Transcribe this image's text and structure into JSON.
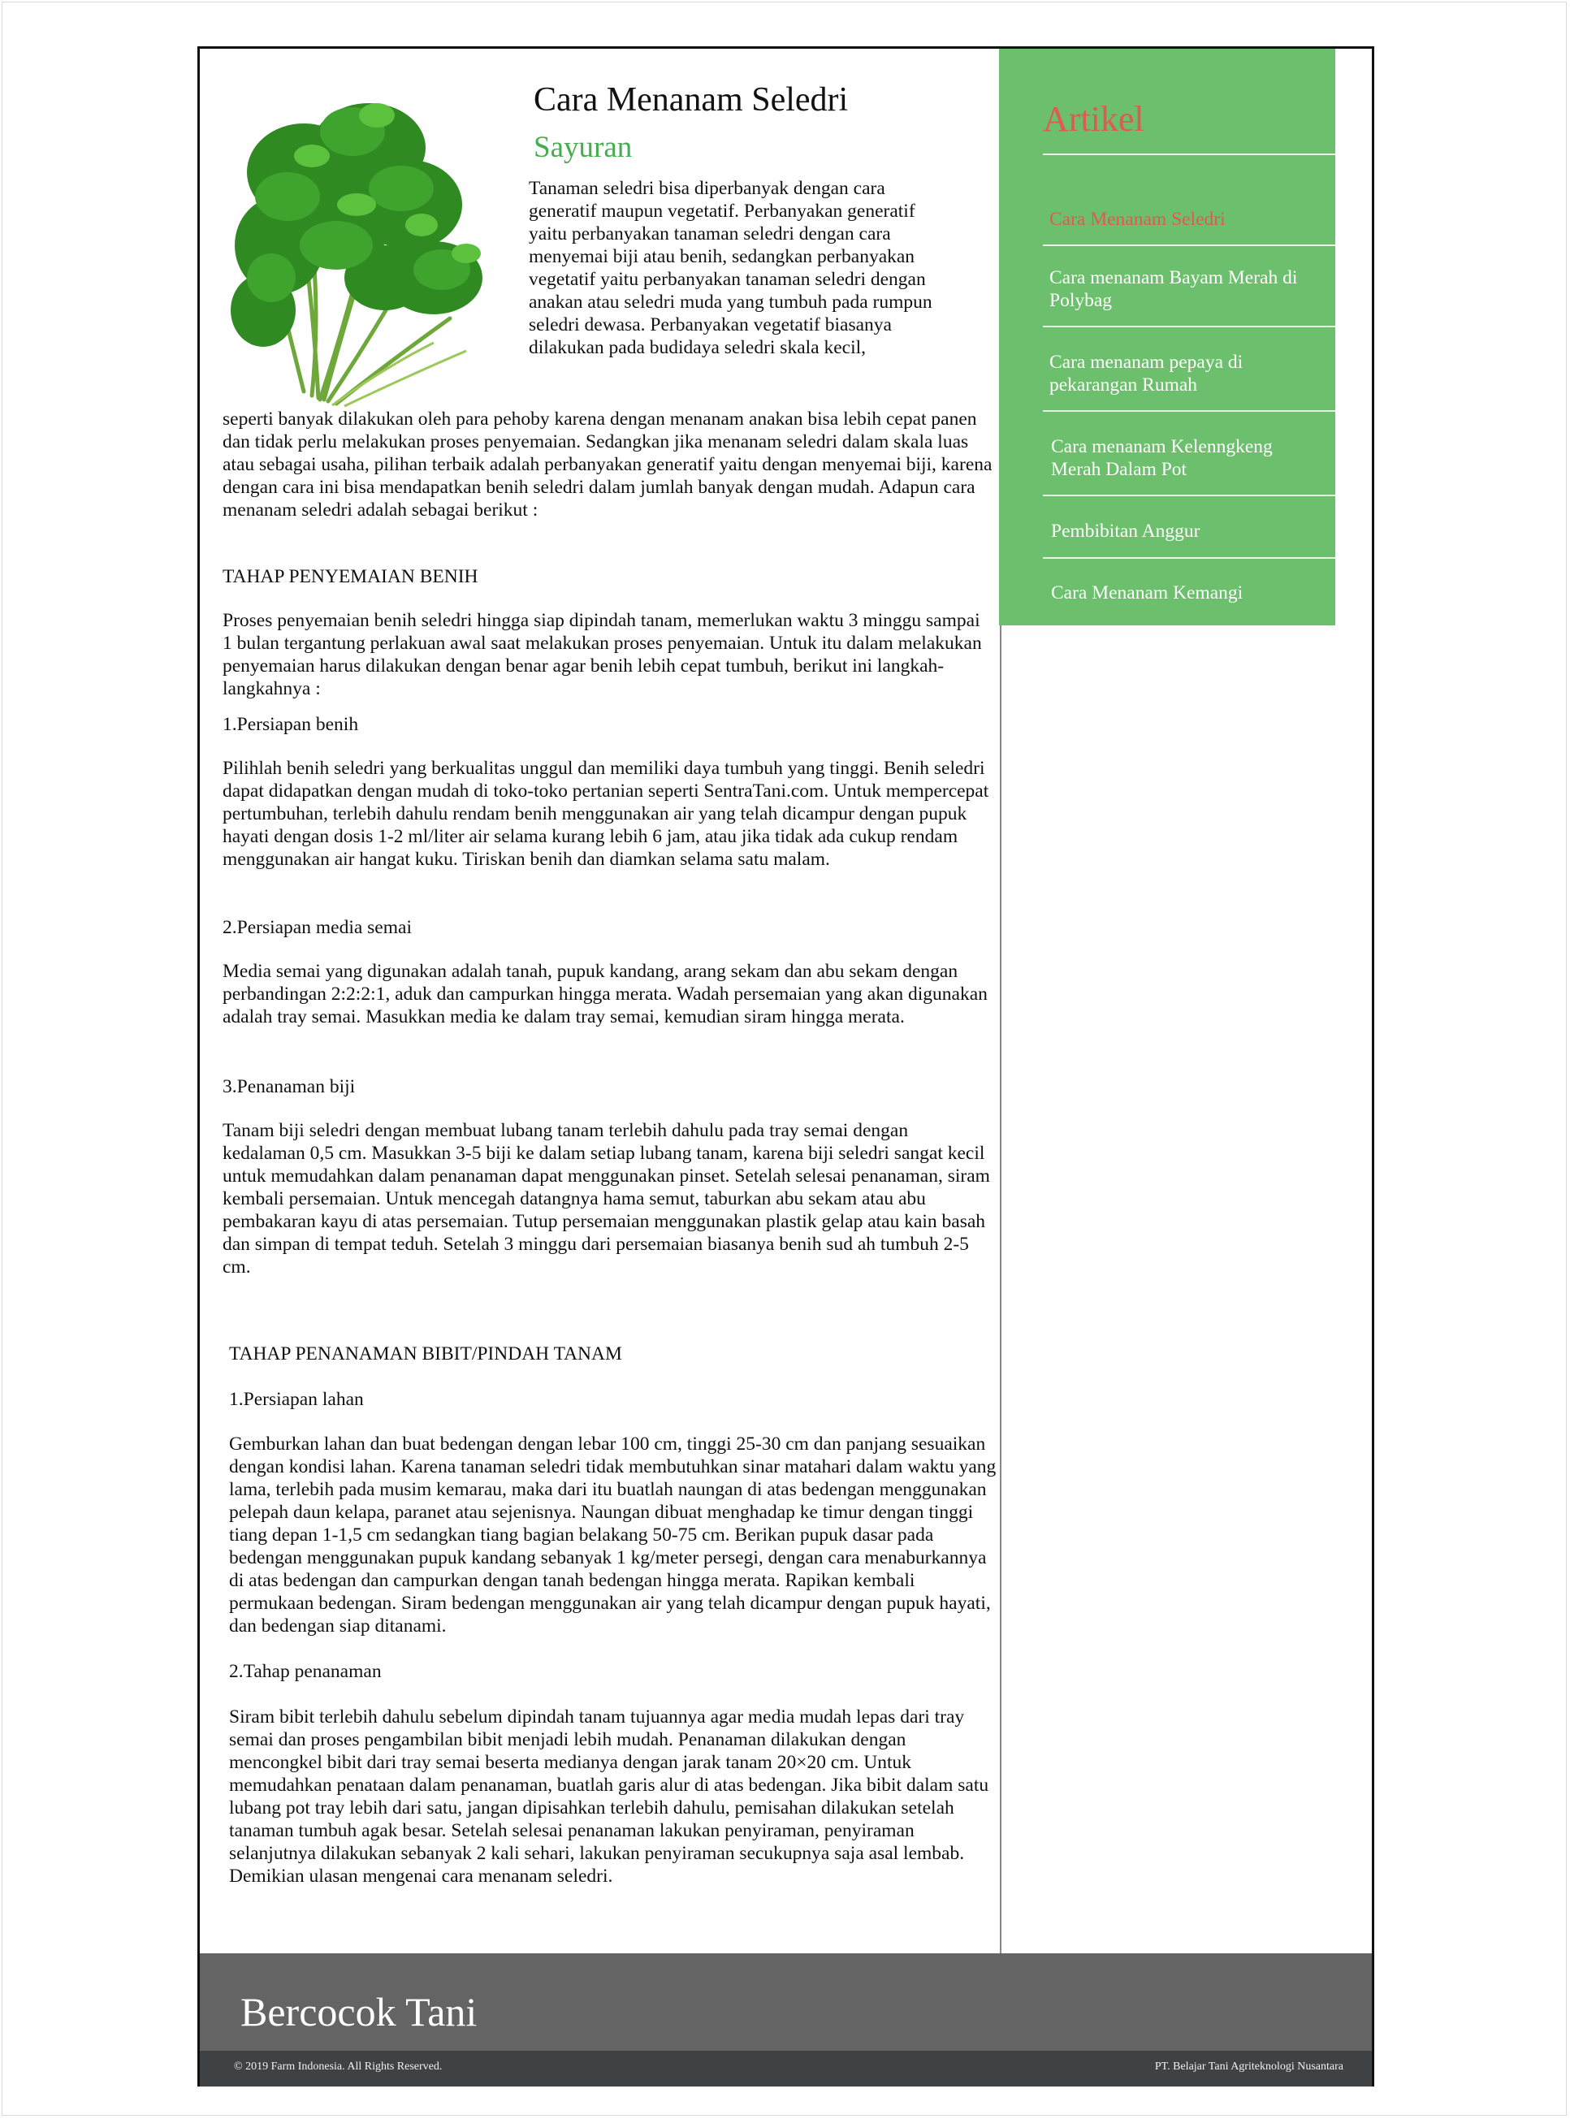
{
  "article": {
    "title": "Cara Menanam Seledri",
    "category": "Sayuran",
    "intro_side": "Tanaman seledri bisa diperbanyak dengan cara generatif maupun vegetatif. Perbanyakan generatif yaitu perbanyakan tanaman seledri dengan cara menyemai biji atau benih, sedangkan perbanyakan vegetatif yaitu perbanyakan tanaman seledri dengan anakan atau seledri muda yang tumbuh pada rumpun seledri dewasa. Perbanyakan vegetatif biasanya dilakukan pada budidaya seledri skala kecil,",
    "intro_rest": "seperti banyak dilakukan oleh para pehoby karena dengan menanam anakan bisa lebih cepat panen dan tidak perlu melakukan proses penyemaian. Sedangkan jika menanam seledri dalam skala luas atau sebagai usaha, pilihan terbaik adalah perbanyakan generatif yaitu dengan menyemai biji, karena dengan cara ini bisa mendapatkan benih seledri dalam jumlah banyak dengan mudah. Adapun cara menanam seledri adalah sebagai berikut :",
    "section1": {
      "heading": "TAHAP PENYEMAIAN BENIH",
      "intro": "Proses penyemaian benih seledri hingga siap dipindah tanam, memerlukan waktu 3 minggu sampai 1 bulan tergantung perlakuan awal saat melakukan proses penyemaian. Untuk itu dalam melakukan penyemaian harus dilakukan dengan benar agar benih lebih cepat tumbuh, berikut ini langkah-langkahnya :",
      "step1_title": "1.Persiapan benih",
      "step1_body": "Pilihlah benih seledri yang berkualitas unggul dan memiliki daya tumbuh yang tinggi. Benih seledri dapat didapatkan dengan mudah di toko-toko pertanian seperti SentraTani.com. Untuk mempercepat pertumbuhan, terlebih dahulu rendam benih menggunakan air yang telah dicampur dengan pupuk hayati dengan dosis 1-2 ml/liter air selama kurang lebih 6 jam, atau jika tidak ada cukup rendam menggunakan air hangat kuku. Tiriskan benih dan diamkan selama satu malam.",
      "step2_title": "2.Persiapan media semai",
      "step2_body": "Media semai yang digunakan adalah tanah, pupuk kandang, arang sekam dan abu sekam dengan perbandingan 2:2:2:1, aduk dan campurkan hingga merata. Wadah persemaian yang akan digunakan adalah tray semai. Masukkan media ke dalam tray semai, kemudian siram hingga merata.",
      "step3_title": "3.Penanaman biji",
      "step3_body": "Tanam biji seledri dengan membuat lubang tanam terlebih dahulu pada tray semai dengan kedalaman 0,5 cm. Masukkan 3-5 biji ke dalam setiap lubang tanam, karena biji seledri sangat kecil untuk memudahkan dalam penanaman dapat menggunakan pinset. Setelah selesai penanaman, siram kembali persemaian. Untuk mencegah datangnya hama semut, taburkan abu sekam atau abu pembakaran kayu di atas persemaian. Tutup persemaian menggunakan plastik gelap atau kain basah dan simpan di tempat teduh. Setelah 3 minggu dari persemaian biasanya benih sud ah tumbuh 2-5 cm."
    },
    "section2": {
      "heading": "TAHAP PENANAMAN BIBIT/PINDAH TANAM",
      "step1_title": "1.Persiapan lahan",
      "step1_body": "Gemburkan lahan dan buat bedengan dengan lebar 100 cm, tinggi 25-30 cm dan panjang sesuaikan dengan kondisi lahan. Karena tanaman seledri tidak membutuhkan sinar matahari dalam waktu yang lama, terlebih pada musim kemarau, maka dari itu buatlah naungan di atas bedengan menggunakan pelepah daun kelapa, paranet atau sejenisnya. Naungan dibuat menghadap ke timur dengan tinggi tiang depan 1-1,5 cm sedangkan tiang bagian belakang 50-75 cm. Berikan pupuk dasar pada bedengan menggunakan pupuk kandang sebanyak 1 kg/meter persegi, dengan cara menaburkannya di atas bedengan dan campurkan dengan tanah bedengan hingga merata. Rapikan kembali permukaan bedengan. Siram bedengan menggunakan air yang telah dicampur dengan pupuk hayati, dan bedengan siap ditanami.",
      "step2_title": "2.Tahap penanaman",
      "step2_body": "Siram bibit terlebih dahulu sebelum dipindah tanam tujuannya agar media mudah lepas dari tray semai dan proses pengambilan bibit menjadi lebih mudah. Penanaman dilakukan dengan mencongkel bibit dari tray semai beserta medianya dengan jarak tanam 20×20 cm. Untuk memudahkan penataan dalam penanaman, buatlah garis alur di atas bedengan. Jika bibit dalam satu lubang pot tray lebih dari satu, jangan dipisahkan terlebih dahulu, pemisahan dilakukan setelah tanaman tumbuh agak besar. Setelah selesai penanaman lakukan penyiraman, penyiraman selanjutnya dilakukan sebanyak 2 kali sehari, lakukan penyiraman secukupnya saja asal lembab. Demikian ulasan mengenai cara menanam seledri."
    }
  },
  "sidebar": {
    "title": "Artikel",
    "links": [
      "Cara Menanam Seledri",
      "Cara menanam Bayam Merah di Polybag",
      "Cara menanam pepaya di pekarangan Rumah",
      "Cara menanam Kelenngkeng Merah Dalam Pot",
      "Pembibitan Anggur",
      "Cara Menanam Kemangi"
    ]
  },
  "footer": {
    "brand": "Bercocok Tani",
    "copyright": "© 2019 Farm Indonesia. All Rights Reserved.",
    "company": "PT. Belajar Tani Agriteknologi Nusantara"
  },
  "colors": {
    "accent_green": "#6cbf6c",
    "category_green": "#44ae4e",
    "active_link_red": "#e05a4f",
    "footer_gray": "#646464",
    "copyright_bar": "#3f4245"
  },
  "icons": {
    "hero_image": "celery-bunch-image"
  }
}
